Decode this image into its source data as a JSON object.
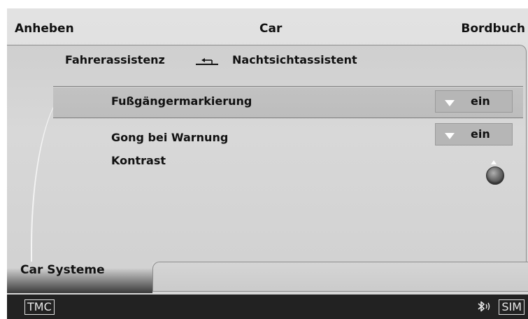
{
  "header": {
    "left": "Anheben",
    "center": "Car",
    "right": "Bordbuch"
  },
  "breadcrumb": {
    "parent": "Fahrerassistenz",
    "current": "Nachtsichtassistent",
    "back_icon": "back-arrow-icon"
  },
  "settings": [
    {
      "label": "Fußgängermarkierung",
      "value": "ein",
      "control": "dropdown",
      "selected": true
    },
    {
      "label": "Gong bei Warnung",
      "value": "ein",
      "control": "dropdown",
      "selected": false
    },
    {
      "label": "Kontrast",
      "control": "rotary-knob",
      "selected": false
    }
  ],
  "bottom": {
    "tab_label": "Car Systeme"
  },
  "status_bar": {
    "tmc": "TMC",
    "sim": "SIM",
    "bluetooth_icon": "bluetooth-icon"
  },
  "colors": {
    "background": "#d8d8d8",
    "selected_row": "#c0c0c0",
    "dropdown": "#b6b6b6",
    "status_bar": "#222222"
  }
}
